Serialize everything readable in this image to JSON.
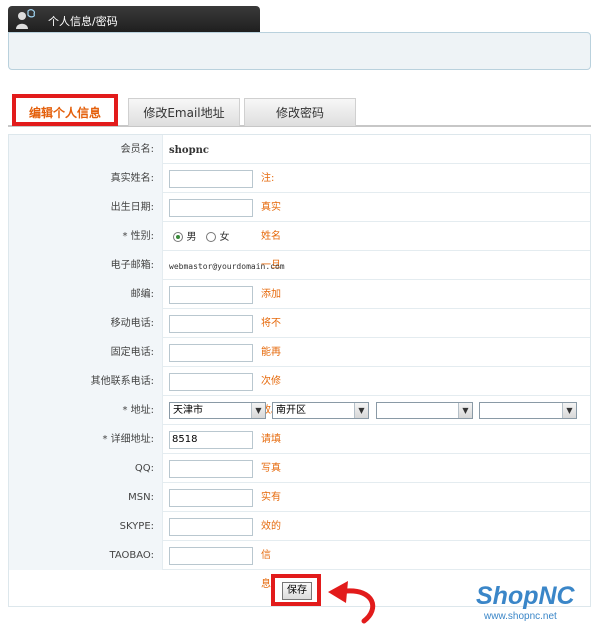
{
  "header": {
    "title": "个人信息/密码"
  },
  "tabs": [
    {
      "label": "编辑个人信息",
      "active": true
    },
    {
      "label": "修改Email地址",
      "active": false
    },
    {
      "label": "修改密码",
      "active": false
    }
  ],
  "form": {
    "username": {
      "label": "会员名:",
      "value": "shopnc"
    },
    "realname": {
      "label": "真实姓名:",
      "value": "",
      "note": "注:真实姓名一旦添加将不能再次修改。"
    },
    "birthday": {
      "label": "出生日期:",
      "value": ""
    },
    "gender": {
      "label": "* 性别:",
      "options": [
        "男",
        "女"
      ],
      "selected": "男"
    },
    "email": {
      "label": "电子邮箱:",
      "value": "webmastor@yourdomain.com"
    },
    "zipcode": {
      "label": "邮编:",
      "value": ""
    },
    "mobile": {
      "label": "移动电话:",
      "value": ""
    },
    "phone": {
      "label": "固定电话:",
      "value": ""
    },
    "other_phone": {
      "label": "其他联系电话:",
      "value": ""
    },
    "address": {
      "label": "* 地址:",
      "province": "天津市",
      "district": "南开区",
      "level3": "",
      "level4": ""
    },
    "detail_address": {
      "label": "* 详细地址:",
      "value": "8518",
      "note": "请填写真实有效的信息。"
    },
    "qq": {
      "label": "QQ:",
      "value": ""
    },
    "msn": {
      "label": "MSN:",
      "value": ""
    },
    "skype": {
      "label": "SKYPE:",
      "value": ""
    },
    "taobao": {
      "label": "TAOBAO:",
      "value": ""
    }
  },
  "actions": {
    "save_label": "保存"
  },
  "logo": {
    "brand": "ShopNC",
    "url": "www.shopnc.net"
  },
  "colors": {
    "accent": "#e4600c",
    "highlight": "#e21b1b",
    "brand": "#3a86c8"
  }
}
